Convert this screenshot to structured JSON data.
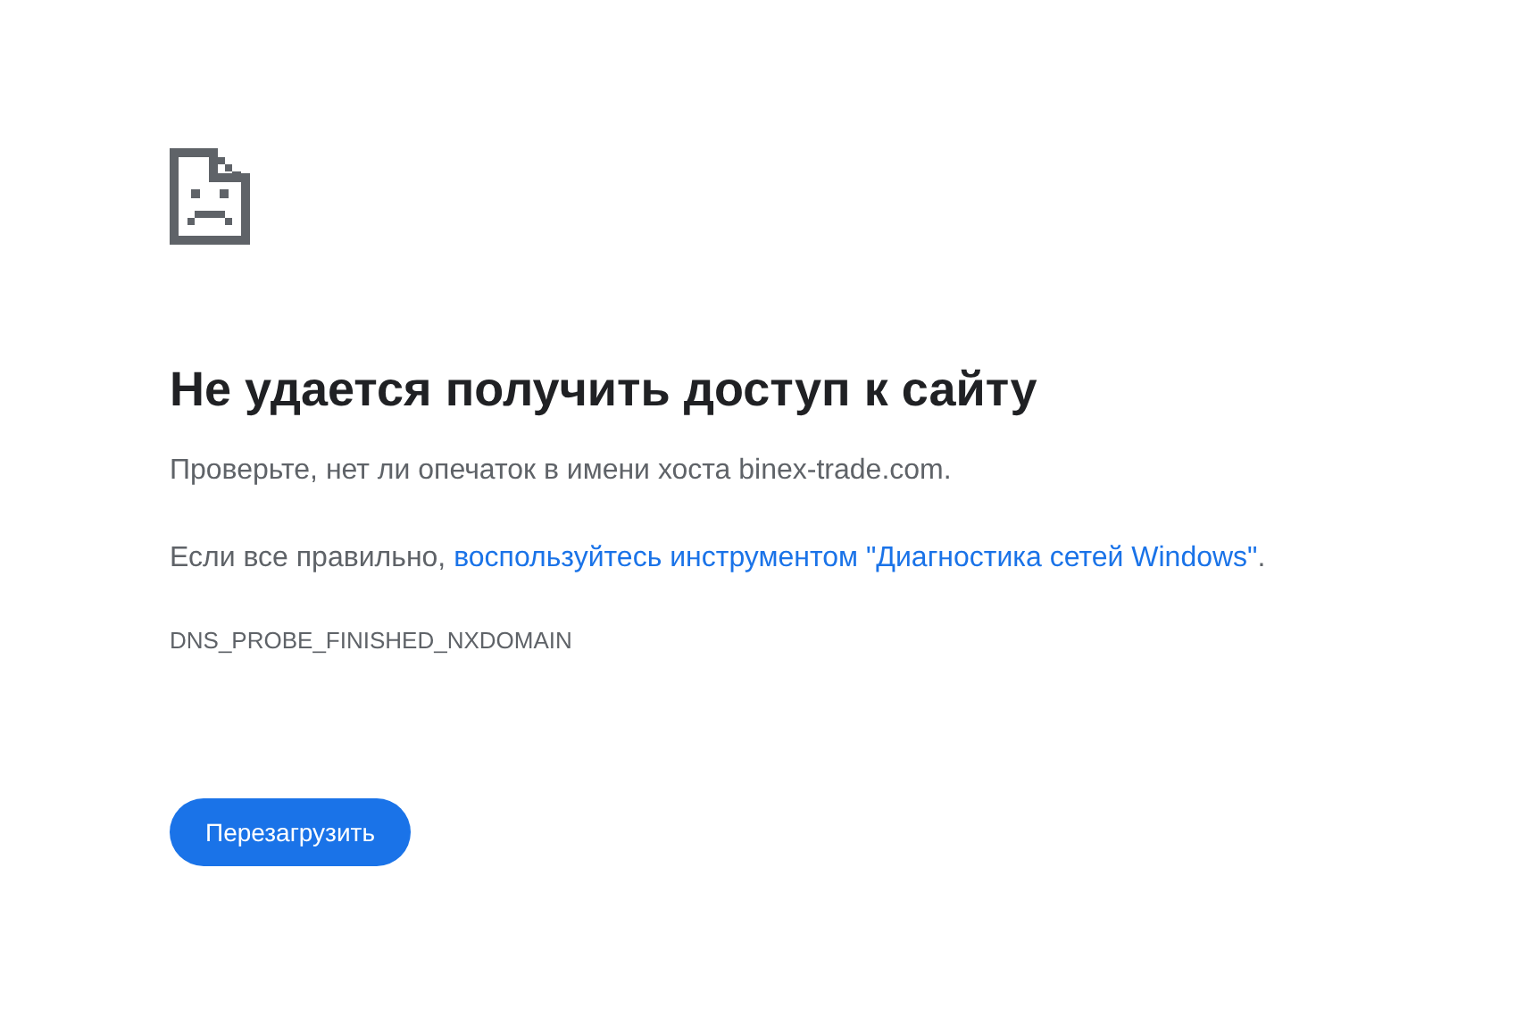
{
  "heading": "Не удается получить доступ к сайту",
  "hint": "Проверьте, нет ли опечаток в имени хоста binex-trade.com.",
  "suggestion": {
    "before": "Если все правильно, ",
    "link": "воспользуйтесь инструментом \"Диагностика сетей Windows\"",
    "after": "."
  },
  "error_code": "DNS_PROBE_FINISHED_NXDOMAIN",
  "buttons": [
    "Перезагрузить"
  ]
}
